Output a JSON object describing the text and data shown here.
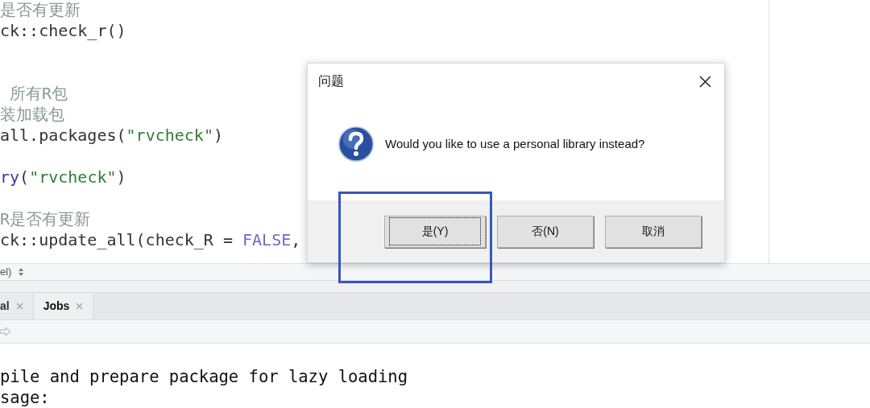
{
  "editor": {
    "lines": [
      {
        "kind": "text",
        "segments": [
          {
            "kind": "comment",
            "text": "是否有更新"
          }
        ]
      },
      {
        "kind": "text",
        "segments": [
          {
            "kind": "code",
            "text": "ck::check_r()"
          }
        ]
      },
      {
        "kind": "blank"
      },
      {
        "kind": "blank"
      },
      {
        "kind": "text",
        "segments": [
          {
            "kind": "comment",
            "text": " 所有R包"
          }
        ]
      },
      {
        "kind": "text",
        "segments": [
          {
            "kind": "comment",
            "text": "装加载包"
          }
        ]
      },
      {
        "kind": "text",
        "segments": [
          {
            "kind": "code",
            "text": "all.packages("
          },
          {
            "kind": "string",
            "text": "\"rvcheck\""
          },
          {
            "kind": "code",
            "text": ")"
          }
        ]
      },
      {
        "kind": "blank"
      },
      {
        "kind": "text",
        "segments": [
          {
            "kind": "function",
            "text": "ry"
          },
          {
            "kind": "code",
            "text": "("
          },
          {
            "kind": "string",
            "text": "\"rvcheck\""
          },
          {
            "kind": "code",
            "text": ")"
          }
        ]
      },
      {
        "kind": "blank"
      },
      {
        "kind": "text",
        "segments": [
          {
            "kind": "comment",
            "text": "R是否有更新"
          }
        ]
      },
      {
        "kind": "text",
        "segments": [
          {
            "kind": "code",
            "text": "ck::update_all(check_R = "
          },
          {
            "kind": "constant",
            "text": "FALSE"
          },
          {
            "kind": "code",
            "text": ","
          }
        ]
      }
    ],
    "status_bar": {
      "scope": "el)"
    }
  },
  "bottom_pane": {
    "tabs": [
      {
        "label": "al",
        "selected": false
      },
      {
        "label": "Jobs",
        "selected": true
      }
    ],
    "console_lines": [
      "pile and prepare package for lazy loading",
      "sage:"
    ]
  },
  "dialog": {
    "title": "问题",
    "message": "Would you like to use a personal library instead?",
    "buttons": [
      {
        "label": "是(Y)",
        "focused": true
      },
      {
        "label": "否(N)",
        "focused": false
      },
      {
        "label": "取消",
        "focused": false
      }
    ]
  }
}
